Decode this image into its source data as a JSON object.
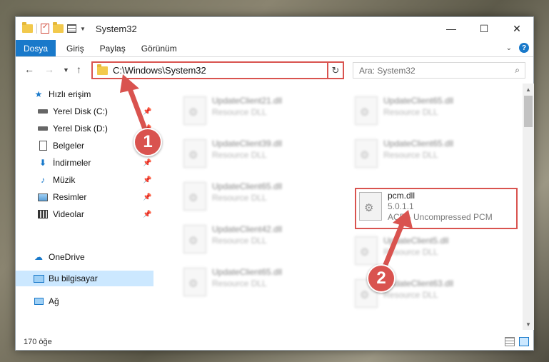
{
  "window": {
    "title": "System32"
  },
  "ribbon": {
    "tabs": [
      "Dosya",
      "Giriş",
      "Paylaş",
      "Görünüm"
    ]
  },
  "address": {
    "path": "C:\\Windows\\System32",
    "search_placeholder": "Ara: System32"
  },
  "sidebar": {
    "items": [
      {
        "label": "Hızlı erişim",
        "icon": "star-icon",
        "pinned": false
      },
      {
        "label": "Yerel Disk (C:)",
        "icon": "drive-icon",
        "pinned": true
      },
      {
        "label": "Yerel Disk (D:)",
        "icon": "drive-icon",
        "pinned": true
      },
      {
        "label": "Belgeler",
        "icon": "documents-icon",
        "pinned": true
      },
      {
        "label": "İndirmeler",
        "icon": "download-icon",
        "pinned": true
      },
      {
        "label": "Müzik",
        "icon": "music-icon",
        "pinned": true
      },
      {
        "label": "Resimler",
        "icon": "pictures-icon",
        "pinned": true
      },
      {
        "label": "Videolar",
        "icon": "video-icon",
        "pinned": true
      },
      {
        "label": "OneDrive",
        "icon": "cloud-icon",
        "pinned": false
      },
      {
        "label": "Bu bilgisayar",
        "icon": "computer-icon",
        "pinned": false,
        "selected": true
      },
      {
        "label": "Ağ",
        "icon": "network-icon",
        "pinned": false
      }
    ]
  },
  "files": [
    {
      "name": "UpdateClient21.dll",
      "sub": "Resource DLL",
      "blurred": true
    },
    {
      "name": "UpdateClient65.dll",
      "sub": "Resource DLL",
      "blurred": true
    },
    {
      "name": "UpdateClient39.dll",
      "sub": "Resource DLL",
      "blurred": true
    },
    {
      "name": "UpdateClient65.dll",
      "sub": "Resource DLL",
      "blurred": true
    },
    {
      "name": "UpdateClient65.dll",
      "sub": "Resource DLL",
      "blurred": true
    },
    {
      "name": "pcm.dll",
      "version": "5.0.1.1",
      "sub": "ACD - Uncompressed PCM",
      "blurred": false,
      "highlighted": true
    },
    {
      "name": "UpdateClient42.dll",
      "sub": "Resource DLL",
      "blurred": true
    },
    {
      "name": "UpdateClient5.dll",
      "sub": "Resource DLL",
      "blurred": true
    },
    {
      "name": "UpdateClient65.dll",
      "sub": "Resource DLL",
      "blurred": true
    },
    {
      "name": "UpdateClient63.dll",
      "sub": "Resource DLL",
      "blurred": true
    }
  ],
  "status": {
    "item_count": "170 öğe"
  },
  "annotations": {
    "step1": "1",
    "step2": "2",
    "color": "#d9534f"
  }
}
